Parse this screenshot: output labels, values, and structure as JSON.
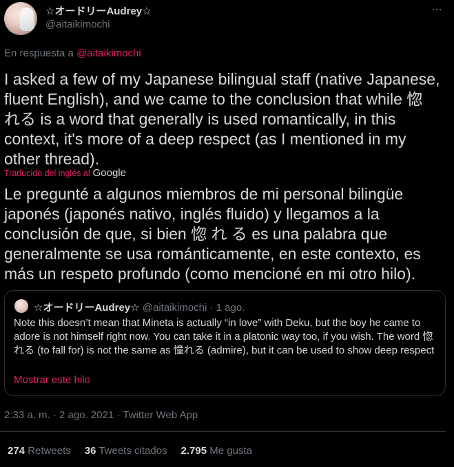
{
  "author": {
    "display_name": "☆オードリーAudrey☆",
    "handle": "@aitaikimochi"
  },
  "more_icon": "⋯",
  "reply": {
    "prefix": "En respuesta a",
    "mention": "@aitaikimochi"
  },
  "tweet_text": "I asked a few of my Japanese bilingual staff (native Japanese,\nfluent English), and we came to the conclusion that while 惚\nれる is a word that generally is used romantically, in this\ncontext, it's more of a deep respect (as I mentioned in my\nother thread).",
  "translation": {
    "label": "Traducido del inglés al",
    "provider": "Google",
    "text": "Le pregunté a algunos miembros de mi personal bilingüe\njaponés (japonés nativo, inglés fluido) y llegamos a la\nconclusión de que, si bien 惚 れ る es una palabra que\ngeneralmente se usa románticamente, en este contexto, es\nmás un respeto profundo (como mencioné en mi otro hilo)."
  },
  "quote": {
    "display_name": "☆オードリーAudrey☆",
    "meta": "@aitaikimochi · 1 ago.",
    "text": "Note this doesn’t mean that Mineta is actually “in love” with Deku, but the boy he came to adore is not himself right now. You can take it in a platonic way too, if you wish. The word 惚れる (to fall for) is not the same as 憧れる (admire), but it can be used to show deep respect",
    "show_thread": "Mostrar este hilo"
  },
  "timestamp": "2:33 a. m. · 2 ago. 2021 · Twitter Web App",
  "stats": {
    "retweets_count": "274",
    "retweets_label": "Retweets",
    "quotes_count": "36",
    "quotes_label": "Tweets citados",
    "likes_count": "2.795",
    "likes_label": "Me gusta"
  },
  "colors": {
    "background": "#000000",
    "text": "#d9d9d9",
    "muted": "#6e767d",
    "accent": "#e0245e",
    "border": "#2f3336"
  }
}
